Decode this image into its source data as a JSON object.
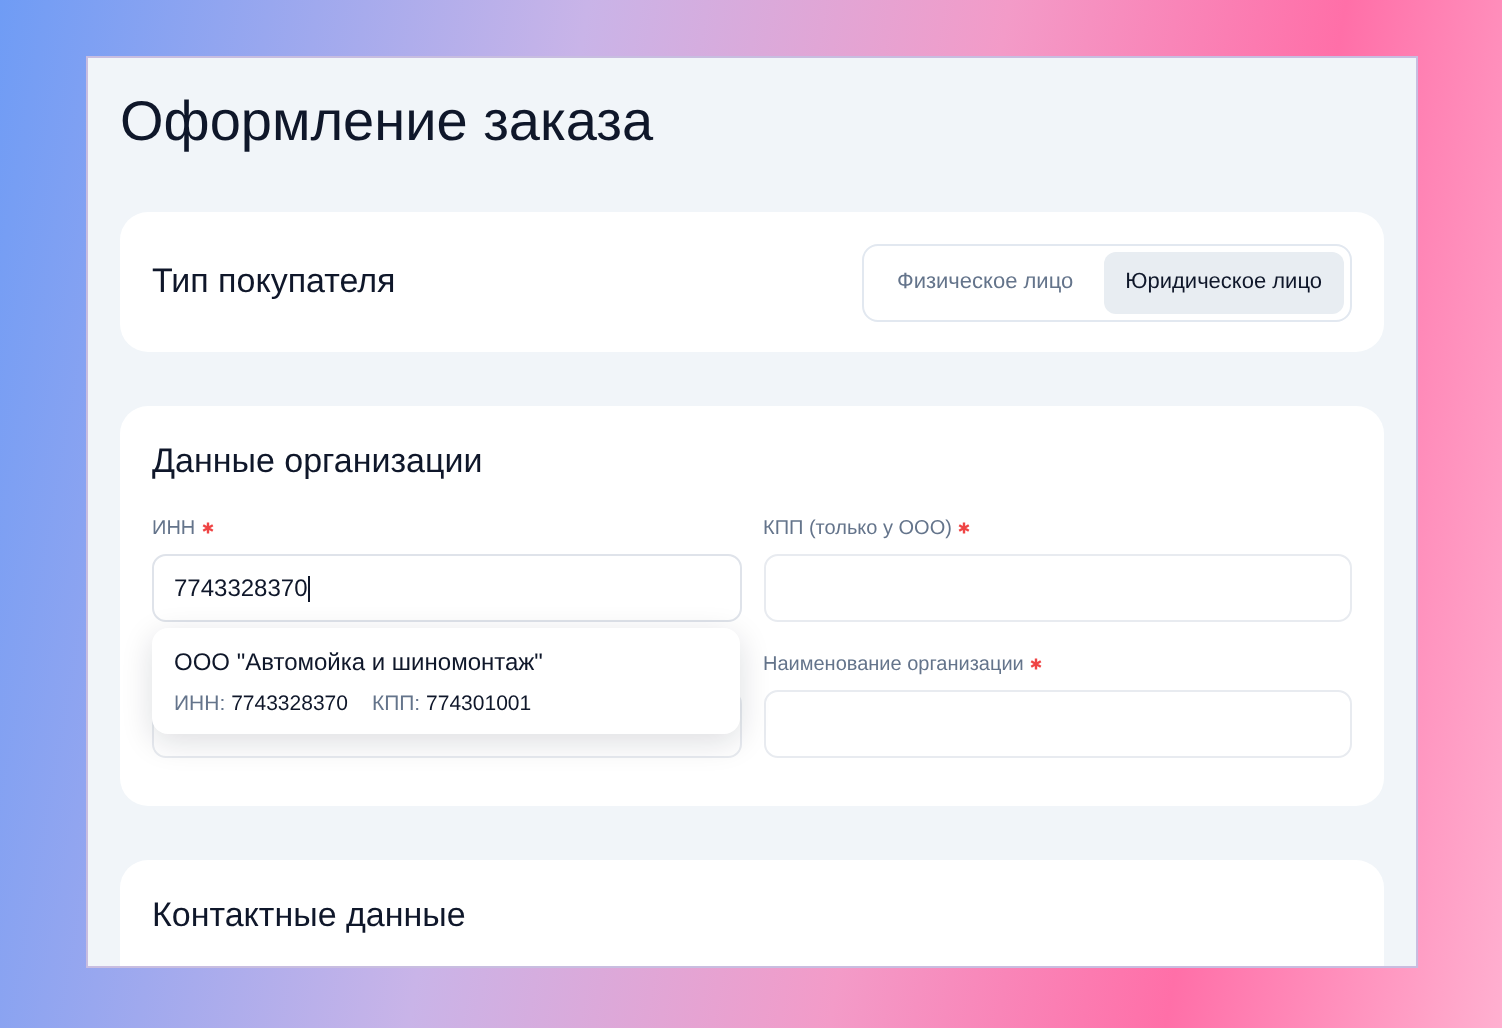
{
  "page_title": "Оформление заказа",
  "buyer_type": {
    "title": "Тип покупателя",
    "options": [
      {
        "label": "Физическое лицо",
        "selected": false
      },
      {
        "label": "Юридическое лицо",
        "selected": true
      }
    ]
  },
  "organization": {
    "title": "Данные организации",
    "fields": [
      {
        "label": "ИНН",
        "required": true,
        "value": "7743328370",
        "focused": true
      },
      {
        "label": "КПП (только у ООО)",
        "required": true,
        "focused": false
      },
      {
        "focused": false
      },
      {
        "label": "Наименование организации",
        "required": true,
        "focused": false
      }
    ],
    "suggestion": {
      "name": "ООО \"Автомойка и шиномонтаж\"",
      "inn_label": "ИНН:",
      "inn": "7743328370",
      "kpp_label": "КПП:",
      "kpp": "774301001"
    }
  },
  "contacts": {
    "title": "Контактные данные"
  }
}
